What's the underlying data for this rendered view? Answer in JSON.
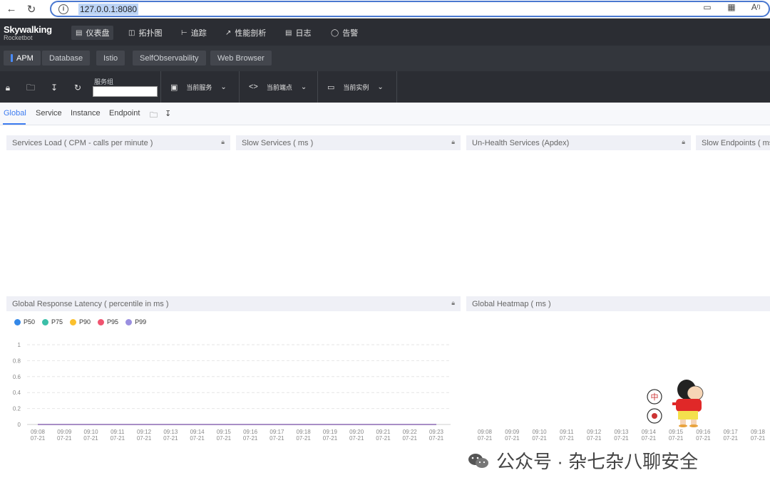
{
  "browser": {
    "url": "127.0.0.1:8080"
  },
  "logo": {
    "line1": "Skywalking",
    "line2": "Rocketbot"
  },
  "nav": {
    "items": [
      {
        "label": "仪表盘",
        "icon": "dashboard-icon",
        "active": true
      },
      {
        "label": "拓扑图",
        "icon": "topology-icon"
      },
      {
        "label": "追踪",
        "icon": "trace-icon"
      },
      {
        "label": "性能剖析",
        "icon": "profile-icon"
      },
      {
        "label": "日志",
        "icon": "log-icon"
      },
      {
        "label": "告警",
        "icon": "alarm-icon"
      }
    ]
  },
  "layers": {
    "tabs": [
      "APM",
      "Database",
      "Istio",
      "SelfObservability",
      "Web Browser"
    ],
    "active": "APM"
  },
  "toolbar": {
    "group_label": "服务组",
    "group_value": "",
    "service_label": "当前服务",
    "endpoint_label": "当前端点",
    "instance_label": "当前实例"
  },
  "dashboard_tabs": {
    "tabs": [
      "Global",
      "Service",
      "Instance",
      "Endpoint"
    ],
    "active": "Global"
  },
  "widgets": {
    "services_load": "Services Load ( CPM - calls per minute )",
    "slow_services": "Slow Services ( ms )",
    "unhealth_services": "Un-Health Services (Apdex)",
    "slow_endpoints": "Slow Endpoints ( ms",
    "response_latency": "Global Response Latency ( percentile in ms )",
    "heatmap": "Global Heatmap ( ms )"
  },
  "chart_data": [
    {
      "type": "line",
      "title": "Global Response Latency ( percentile in ms )",
      "series": [
        {
          "name": "P50",
          "color": "#3388e8",
          "values": [
            0,
            0,
            0,
            0,
            0,
            0,
            0,
            0,
            0,
            0,
            0,
            0,
            0,
            0,
            0,
            0
          ]
        },
        {
          "name": "P75",
          "color": "#3bbfa8",
          "values": [
            0,
            0,
            0,
            0,
            0,
            0,
            0,
            0,
            0,
            0,
            0,
            0,
            0,
            0,
            0,
            0
          ]
        },
        {
          "name": "P90",
          "color": "#fbc02d",
          "values": [
            0,
            0,
            0,
            0,
            0,
            0,
            0,
            0,
            0,
            0,
            0,
            0,
            0,
            0,
            0,
            0
          ]
        },
        {
          "name": "P95",
          "color": "#f05470",
          "values": [
            0,
            0,
            0,
            0,
            0,
            0,
            0,
            0,
            0,
            0,
            0,
            0,
            0,
            0,
            0,
            0
          ]
        },
        {
          "name": "P99",
          "color": "#9a8fe0",
          "values": [
            0,
            0,
            0,
            0,
            0,
            0,
            0,
            0,
            0,
            0,
            0,
            0,
            0,
            0,
            0,
            0
          ]
        }
      ],
      "x_times": [
        "09:08",
        "09:09",
        "09:10",
        "09:11",
        "09:12",
        "09:13",
        "09:14",
        "09:15",
        "09:16",
        "09:17",
        "09:18",
        "09:19",
        "09:20",
        "09:21",
        "09:22",
        "09:23"
      ],
      "x_date": "07-21",
      "yticks": [
        "1",
        "0.8",
        "0.6",
        "0.4",
        "0.2",
        "0"
      ],
      "ylim": [
        0,
        1
      ],
      "grid": true,
      "legend_position": "top-left"
    },
    {
      "type": "heatmap",
      "title": "Global Heatmap ( ms )",
      "x_times": [
        "09:08",
        "09:09",
        "09:10",
        "09:11",
        "09:12",
        "09:13",
        "09:14",
        "09:15",
        "09:16",
        "09:17",
        "09:18"
      ],
      "x_date": "07-21"
    }
  ],
  "watermark": {
    "text": "公众号 · 杂七杂八聊安全"
  },
  "mascot": {
    "badge1": "中"
  },
  "colors": {
    "accent": "#3d7cf0",
    "nav_bg": "#2b2d33",
    "layer_bg": "#33363c"
  }
}
